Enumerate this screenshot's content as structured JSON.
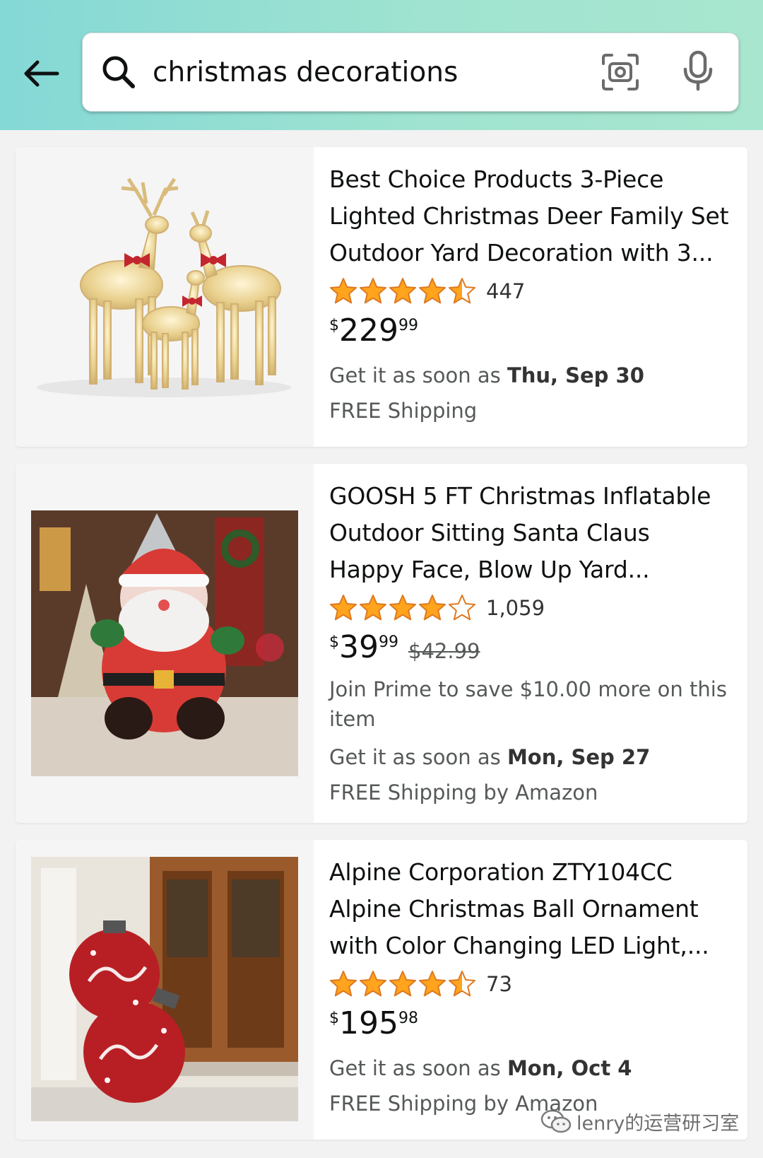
{
  "search": {
    "query": "christmas decorations",
    "back_icon": "arrow-left-icon",
    "search_icon": "magnifier-icon",
    "camera_icon": "camera-scan-icon",
    "mic_icon": "microphone-icon"
  },
  "colors": {
    "header_gradient_start": "#84d8d6",
    "header_gradient_end": "#a8e6cf",
    "star": "#ffa41c",
    "text": "#0f1111",
    "muted": "#565959"
  },
  "products": [
    {
      "title_line1": "Best Choice Products 3-Piece",
      "title_line2": "Lighted Christmas Deer Family Set",
      "title_line3": "Outdoor Yard Decoration with 3...",
      "rating": 4.5,
      "review_count": "447",
      "price_symbol": "$",
      "price_whole": "229",
      "price_fraction": "99",
      "delivery_prefix": "Get it as soon as ",
      "delivery_date": "Thu, Sep 30",
      "shipping": "FREE Shipping",
      "image": "lighted-deer-family"
    },
    {
      "title_line1": "GOOSH 5 FT Christmas Inflatable",
      "title_line2": "Outdoor Sitting Santa Claus",
      "title_line3": "Happy Face, Blow Up Yard...",
      "rating": 4,
      "review_count": "1,059",
      "price_symbol": "$",
      "price_whole": "39",
      "price_fraction": "99",
      "list_price": "$42.99",
      "prime_line1": "Join Prime to save $10.00 more on this",
      "prime_line2": "item",
      "delivery_prefix": "Get it as soon as ",
      "delivery_date": "Mon, Sep 27",
      "shipping": "FREE Shipping by Amazon",
      "image": "inflatable-santa"
    },
    {
      "title_line1": "Alpine Corporation ZTY104CC",
      "title_line2": "Alpine Christmas Ball Ornament",
      "title_line3": "with Color Changing LED Light,...",
      "rating": 4.5,
      "review_count": "73",
      "price_symbol": "$",
      "price_whole": "195",
      "price_fraction": "98",
      "delivery_prefix": "Get it as soon as ",
      "delivery_date": "Mon, Oct 4",
      "shipping": "FREE Shipping by Amazon",
      "image": "christmas-ball-ornaments"
    }
  ],
  "watermark": {
    "text": "lenry的运营研习室",
    "icon": "wechat-icon"
  }
}
